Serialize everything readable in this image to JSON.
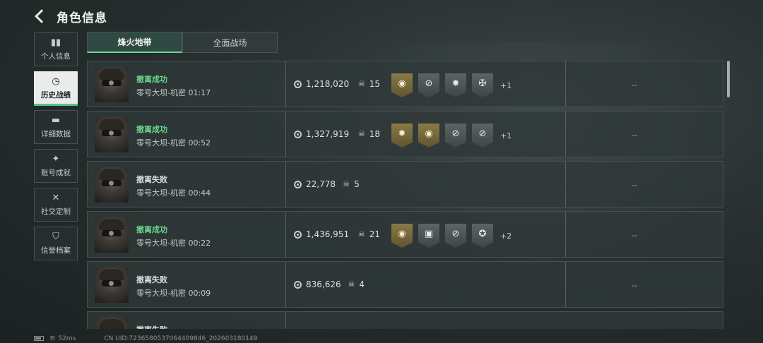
{
  "header": {
    "title": "角色信息"
  },
  "sidebar": {
    "items": [
      {
        "label": "个人信息",
        "icon": "bar-chart-icon",
        "glyph": "▮▮"
      },
      {
        "label": "历史战绩",
        "icon": "clock-icon",
        "glyph": "◷",
        "active": true
      },
      {
        "label": "详细数据",
        "icon": "folder-icon",
        "glyph": "▬"
      },
      {
        "label": "账号成就",
        "icon": "medal-icon",
        "glyph": "✦"
      },
      {
        "label": "社交定制",
        "icon": "tools-icon",
        "glyph": "✕"
      },
      {
        "label": "信誉档案",
        "icon": "shield-icon",
        "glyph": "⛉"
      }
    ]
  },
  "tabs": [
    {
      "label": "烽火地带",
      "active": true
    },
    {
      "label": "全面战场",
      "active": false
    }
  ],
  "matches": [
    {
      "status": "撤离成功",
      "success": true,
      "map_time": "零号大坝-机密 01:17",
      "coins": "1,218,020",
      "kills": "15",
      "badges": [
        {
          "tone": "gold",
          "glyph": "◉"
        },
        {
          "tone": "silver",
          "glyph": "⊘"
        },
        {
          "tone": "silver",
          "glyph": "✸"
        },
        {
          "tone": "silver",
          "glyph": "✠"
        }
      ],
      "extra": "+1",
      "dash": "--"
    },
    {
      "status": "撤离成功",
      "success": true,
      "map_time": "零号大坝-机密 00:52",
      "coins": "1,327,919",
      "kills": "18",
      "badges": [
        {
          "tone": "gold",
          "glyph": "✹"
        },
        {
          "tone": "gold",
          "glyph": "◉"
        },
        {
          "tone": "silver",
          "glyph": "⊘"
        },
        {
          "tone": "silver",
          "glyph": "⊘"
        }
      ],
      "extra": "+1",
      "dash": "--"
    },
    {
      "status": "撤离失败",
      "success": false,
      "map_time": "零号大坝-机密 00:44",
      "coins": "22,778",
      "kills": "5",
      "badges": [],
      "extra": "",
      "dash": "--"
    },
    {
      "status": "撤离成功",
      "success": true,
      "map_time": "零号大坝-机密 00:22",
      "coins": "1,436,951",
      "kills": "21",
      "badges": [
        {
          "tone": "gold",
          "glyph": "◉"
        },
        {
          "tone": "silver",
          "glyph": "▣"
        },
        {
          "tone": "silver",
          "glyph": "⊘"
        },
        {
          "tone": "silver",
          "glyph": "✪"
        }
      ],
      "extra": "+2",
      "dash": "--"
    },
    {
      "status": "撤离失败",
      "success": false,
      "map_time": "零号大坝-机密 00:09",
      "coins": "836,626",
      "kills": "4",
      "badges": [],
      "extra": "",
      "dash": "--"
    },
    {
      "status": "撤离失败",
      "success": false,
      "map_time": "",
      "coins": "",
      "kills": "",
      "badges": [],
      "extra": "",
      "dash": ""
    }
  ],
  "footer": {
    "ping": "52ms",
    "uid": "CN UID:7236580537064409846_202603180149"
  },
  "colors": {
    "success": "#69d68c",
    "accent": "#6fd199"
  }
}
